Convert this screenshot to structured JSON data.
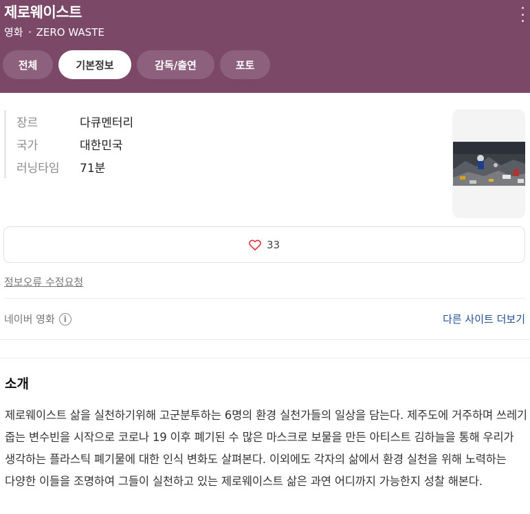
{
  "header": {
    "title": "제로웨이스트",
    "category": "영화",
    "original_title": "ZERO WASTE",
    "bg_color": "#7b4868"
  },
  "tabs": [
    {
      "label": "전체",
      "active": false
    },
    {
      "label": "기본정보",
      "active": true
    },
    {
      "label": "감독/출연",
      "active": false
    },
    {
      "label": "포토",
      "active": false
    }
  ],
  "info": {
    "genre_label": "장르",
    "genre": "다큐멘터리",
    "country_label": "국가",
    "country": "대한민국",
    "runtime_label": "러닝타임",
    "runtime": "71분"
  },
  "poster": {
    "icon": "poster-thumbnail"
  },
  "likes": {
    "count": "33",
    "icon": "heart-outline-icon",
    "color": "#e0323c"
  },
  "report_link": "정보오류 수정요청",
  "source": {
    "label": "네이버 영화",
    "icon": "info-circle-icon",
    "more_link": "다른 사이트 더보기"
  },
  "intro": {
    "title": "소개",
    "body": "제로웨이스트 삶을 실천하기위해 고군분투하는 6명의 환경 실천가들의 일상을 담는다. 제주도에 거주하며 쓰레기 줍는 변수빈을 시작으로 코로나 19 이후 폐기된 수 많은 마스크로 보물을 만든 아티스트 김하늘을 통해 우리가 생각하는 플라스틱 폐기물에 대한 인식 변화도 살펴본다. 이외에도 각자의 삶에서 환경 실천을 위해 노력하는 다양한 이들을 조명하여 그들이 실천하고 있는 제로웨이스트 삶은 과연 어디까지 가능한지 성찰 해본다."
  }
}
